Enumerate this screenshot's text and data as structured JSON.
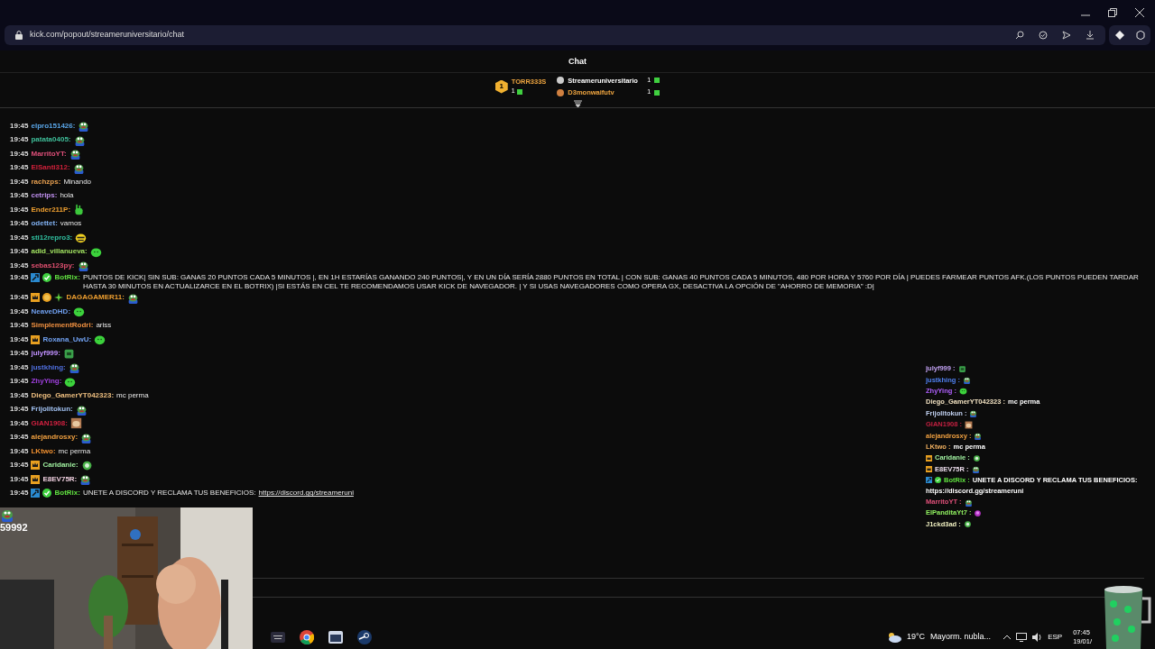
{
  "browser": {
    "url": "kick.com/popout/streameruniversitario/chat"
  },
  "chat": {
    "title": "Chat",
    "leaderboard": [
      {
        "rank": "1",
        "user": "TORR333S",
        "count": "1",
        "color": "#f0a640"
      },
      {
        "user": "Streameruniversitario",
        "count": "1",
        "color": "#ffffff"
      },
      {
        "user": "D3monwaifutv",
        "count": "1",
        "color": "#f0a640"
      }
    ],
    "messages": [
      {
        "time": "19:45",
        "user": "elpro151426:",
        "color": "#5aa6e8",
        "emote": {
          "kind": "frog"
        }
      },
      {
        "time": "19:45",
        "user": "patata0405:",
        "color": "#3fbf9a",
        "emote": {
          "kind": "frog"
        }
      },
      {
        "time": "19:45",
        "user": "MarritoYT:",
        "color": "#e0507a",
        "emote": {
          "kind": "frog"
        }
      },
      {
        "time": "19:45",
        "user": "ElSanti312:",
        "color": "#d0203a",
        "emote": {
          "kind": "frog"
        }
      },
      {
        "time": "19:45",
        "user": "rachzps:",
        "color": "#e8a050",
        "text": "Minando"
      },
      {
        "time": "19:45",
        "user": "cetrips:",
        "color": "#c090f0",
        "text": "hola"
      },
      {
        "time": "19:45",
        "user": "Ender211P:",
        "color": "#f0a030",
        "emote": {
          "kind": "hand"
        }
      },
      {
        "time": "19:45",
        "user": "odettet:",
        "color": "#80b0f0",
        "text": "vamos"
      },
      {
        "time": "19:45",
        "user": "sti12repro3:",
        "color": "#30c0a0",
        "emote": {
          "kind": "bee"
        }
      },
      {
        "time": "19:45",
        "user": "adid_villanueva:",
        "color": "#a0e060",
        "emote": {
          "kind": "blob"
        }
      },
      {
        "time": "19:45",
        "user": "sebas123py:",
        "color": "#e05070",
        "emote": {
          "kind": "frog"
        }
      },
      {
        "time": "19:45",
        "badges": [
          {
            "kind": "bot"
          },
          {
            "kind": "verified"
          }
        ],
        "user": "BotRix:",
        "color": "#60e040",
        "text": "PUNTOS DE KICK| SIN SUB: GANAS 20 PUNTOS CADA 5 MINUTOS |, EN 1H ESTARÍAS GANANDO 240 PUNTOS|, Y EN UN DÍA SERÍA 2880 PUNTOS EN TOTAL | CON SUB: GANAS 40 PUNTOS CADA 5 MINUTOS, 480 POR HORA Y 5760 POR DÍA | PUEDES FARMEAR PUNTOS AFK.(LOS PUNTOS PUEDEN TARDAR HASTA 30 MINUTOS EN ACTUALIZARCE EN EL BOTRIX) |SI ESTÁS EN CEL TE RECOMENDAMOS USAR KICK DE NAVEGADOR. | Y SI USAS NAVEGADORES COMO OPERA GX, DESACTIVA LA OPCIÓN DE \"AHORRO DE MEMORIA\" :D|"
      },
      {
        "time": "19:45",
        "badges": [
          {
            "kind": "crown"
          },
          {
            "kind": "coin"
          },
          {
            "kind": "sparkle"
          }
        ],
        "user": "DAGAGAMER11:",
        "color": "#f0a030",
        "emote": {
          "kind": "frog"
        }
      },
      {
        "time": "19:45",
        "user": "NeaveDHD:",
        "color": "#70a0f0",
        "emote": {
          "kind": "blob"
        }
      },
      {
        "time": "19:45",
        "user": "SimplementRodri:",
        "color": "#f09040",
        "text": "ariss"
      },
      {
        "time": "19:45",
        "badges": [
          {
            "kind": "crown"
          }
        ],
        "user": "Roxana_UwU:",
        "color": "#70a0f0",
        "emote": {
          "kind": "blob"
        }
      },
      {
        "time": "19:45",
        "user": "julyf999:",
        "color": "#c090ff",
        "emote": {
          "kind": "box"
        }
      },
      {
        "time": "19:45",
        "user": "justkhing:",
        "color": "#5070e0",
        "emote": {
          "kind": "frog"
        }
      },
      {
        "time": "19:45",
        "user": "ZhyYing:",
        "color": "#a040e0",
        "emote": {
          "kind": "blob"
        }
      },
      {
        "time": "19:45",
        "user": "Diego_GamerYT042323:",
        "color": "#f0c080",
        "text": "mc perma"
      },
      {
        "time": "19:45",
        "user": "Frijolitokun:",
        "color": "#a0c0f0",
        "emote": {
          "kind": "frog"
        }
      },
      {
        "time": "19:45",
        "user": "GIAN1908:",
        "color": "#d02040",
        "emote": {
          "kind": "cat"
        }
      },
      {
        "time": "19:45",
        "user": "alejandrosxy:",
        "color": "#f0a040",
        "emote": {
          "kind": "frog"
        }
      },
      {
        "time": "19:45",
        "user": "LKtwo:",
        "color": "#f09030",
        "text": "mc perma"
      },
      {
        "time": "19:45",
        "badges": [
          {
            "kind": "crown"
          }
        ],
        "user": "Caridanie:",
        "color": "#a0f0a0",
        "emote": {
          "kind": "ball"
        }
      },
      {
        "time": "19:45",
        "badges": [
          {
            "kind": "crown"
          }
        ],
        "user": "E8EV75R:",
        "color": "#f0d0e0",
        "emote": {
          "kind": "frog"
        }
      },
      {
        "time": "19:45",
        "badges": [
          {
            "kind": "bot"
          },
          {
            "kind": "verified"
          }
        ],
        "user": "BotRix:",
        "color": "#60e040",
        "text": "UNETE A DISCORD Y RECLAMA TUS BENEFICIOS:",
        "link": "https://discord.gg/streameruni"
      }
    ]
  },
  "overlay": {
    "counter": "59992",
    "messages": [
      {
        "user": "julyf999 :",
        "color": "#c0a0f0",
        "emote": {
          "kind": "box"
        }
      },
      {
        "user": "justkhing :",
        "color": "#5080f0",
        "emote": {
          "kind": "frog"
        }
      },
      {
        "user": "ZhyYing :",
        "color": "#b060ff",
        "emote": {
          "kind": "blob"
        }
      },
      {
        "user": "Diego_GamerYT042323 :",
        "color": "#f0e0c0",
        "text": "mc perma"
      },
      {
        "user": "Frijolitokun :",
        "color": "#c0d0f0",
        "emote": {
          "kind": "frog"
        }
      },
      {
        "user": "GIAN1908 :",
        "color": "#c02040",
        "emote": {
          "kind": "cat"
        }
      },
      {
        "user": "alejandrosxy :",
        "color": "#f0a040",
        "emote": {
          "kind": "frog"
        }
      },
      {
        "user": "LKtwo :",
        "color": "#f0b060",
        "text": "mc perma"
      },
      {
        "badges": [
          {
            "kind": "crown"
          }
        ],
        "user": "Caridanie :",
        "color": "#a0f0a0",
        "emote": {
          "kind": "ball"
        }
      },
      {
        "badges": [
          {
            "kind": "crown"
          }
        ],
        "user": "E8EV75R :",
        "color": "#f0e0f0",
        "emote": {
          "kind": "frog"
        }
      },
      {
        "badges": [
          {
            "kind": "bot"
          },
          {
            "kind": "verified"
          }
        ],
        "user": "BotRix :",
        "color": "#60e040",
        "text": "UNETE A DISCORD Y RECLAMA TUS BENEFICIOS:",
        "link": "https://discord.gg/streameruni"
      },
      {
        "user": "MarritoYT :",
        "color": "#e0507a",
        "emote": {
          "kind": "frog"
        }
      },
      {
        "user": "ElPanditaYt7 :",
        "color": "#90f060",
        "emote": {
          "kind": "orb"
        }
      },
      {
        "user": "J1ckd3ad :",
        "color": "#f0f0c0",
        "emote": {
          "kind": "ball"
        }
      }
    ]
  },
  "taskbar": {
    "weather": "19°C",
    "forecast": "Mayorm. nubla...",
    "language": "ESP",
    "time": "07:45",
    "date": "19/01/"
  }
}
